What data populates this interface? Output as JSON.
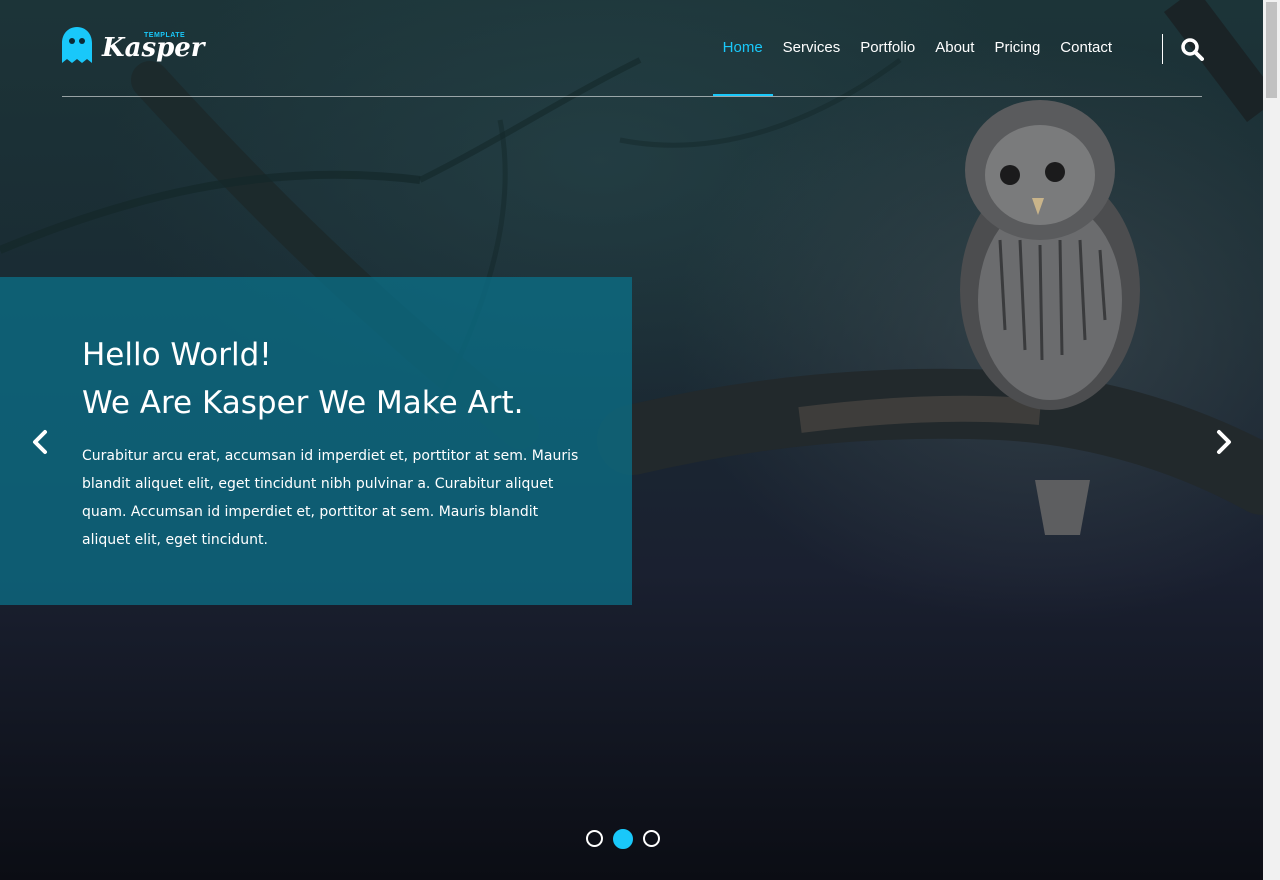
{
  "header": {
    "logo": {
      "word": "Kasper",
      "tag": "TEMPLATE",
      "icon": "ghost-icon"
    },
    "nav": [
      {
        "label": "Home",
        "active": true
      },
      {
        "label": "Services",
        "active": false
      },
      {
        "label": "Portfolio",
        "active": false
      },
      {
        "label": "About",
        "active": false
      },
      {
        "label": "Pricing",
        "active": false
      },
      {
        "label": "Contact",
        "active": false
      }
    ],
    "search_icon": "search-icon"
  },
  "hero": {
    "title_line1": "Hello World!",
    "title_line2": "We Are Kasper We Make Art.",
    "text": "Curabitur arcu erat, accumsan id imperdiet et, porttitor at sem. Mauris blandit aliquet elit, eget tincidunt nibh pulvinar a. Curabitur aliquet quam. Accumsan id imperdiet et, porttitor at sem. Mauris blandit aliquet elit, eget tincidunt.",
    "prev_icon": "chevron-left-icon",
    "next_icon": "chevron-right-icon",
    "slides": {
      "count": 3,
      "active": 2
    }
  },
  "colors": {
    "accent": "#19c8fa",
    "box": "#0a738c"
  }
}
